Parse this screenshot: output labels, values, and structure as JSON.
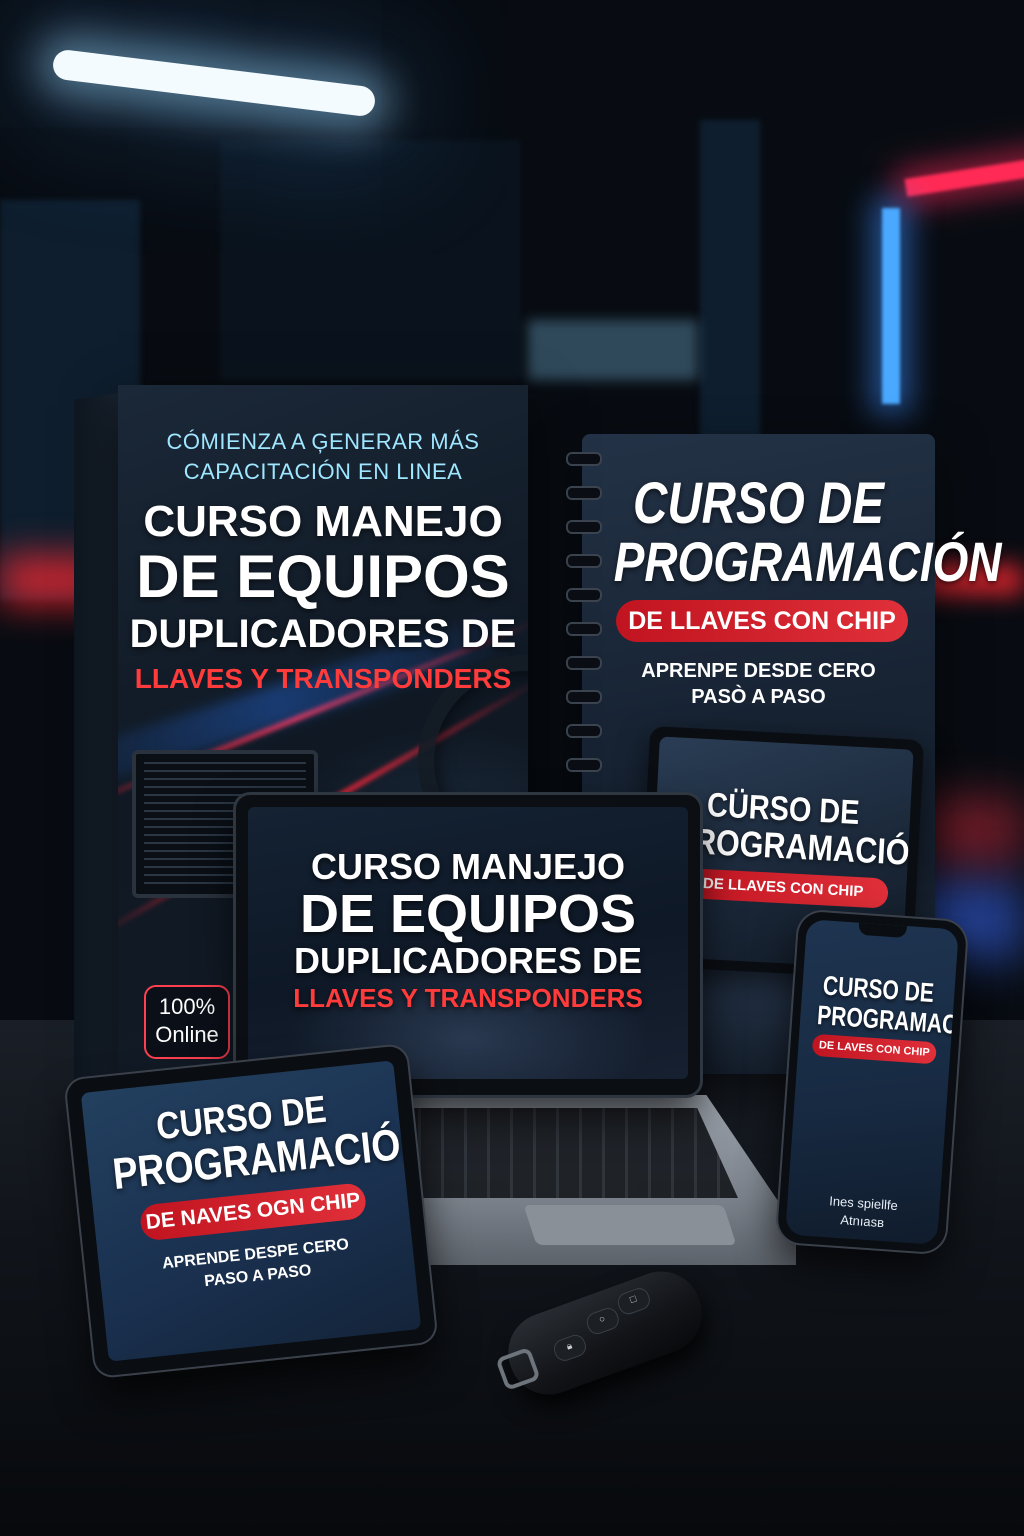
{
  "box": {
    "tagline_line1": "CÓMIENZA A ĢENERAR MÁS",
    "tagline_line2": "CAPACITACIÓN EN LINEA",
    "title_line1": "CURSO MANEJO",
    "title_line2": "DE EQUIPOS",
    "title_line3": "DUPLICADORES DE",
    "title_red": "LLAVES Y TRANSPONDERS",
    "badge_line1": "100%",
    "badge_line2": "Online"
  },
  "notebook": {
    "title_line1": "CURSO DE",
    "title_line2": "PROGRAMACIÓN",
    "pill": "DE LLAVES CON CHIP",
    "sub_line1": "APRENPE DESDE CERO",
    "sub_line2": "PASÒ A PASO"
  },
  "notebook_tablet": {
    "title_line1": "CÜRSO DE",
    "title_line2": "PROGRAMACIÓN",
    "pill": "DE LLAVES CON CHIP"
  },
  "laptop": {
    "title_line1": "CURSO MANJEJO",
    "title_line2": "DE EQUIPOS",
    "title_line3": "DUPLICADORES DE",
    "title_red": "LLAVES Y TRANSPONDERS"
  },
  "tablet": {
    "title_line1": "CURSO DE",
    "title_line2": "PROGRAMACIÓN",
    "pill": "DE NAVES OGN CHIP",
    "sub_line1": "APRENDE DESPE CERO",
    "sub_line2": "PASO A PASO"
  },
  "phone": {
    "title_line1": "CURSO DE",
    "title_line2": "PROGRAMACION",
    "pill": "DE LAVES CON CHIP",
    "foot_line1": "Ines spiellfe",
    "foot_line2": "Atnıasв"
  },
  "colors": {
    "accent_red": "#e0303a",
    "accent_cyan": "#9fe6ff",
    "background": "#050a12"
  },
  "icons": {
    "fob_lock": "lock-icon",
    "fob_unlock": "unlock-icon",
    "fob_trunk": "trunk-icon"
  }
}
